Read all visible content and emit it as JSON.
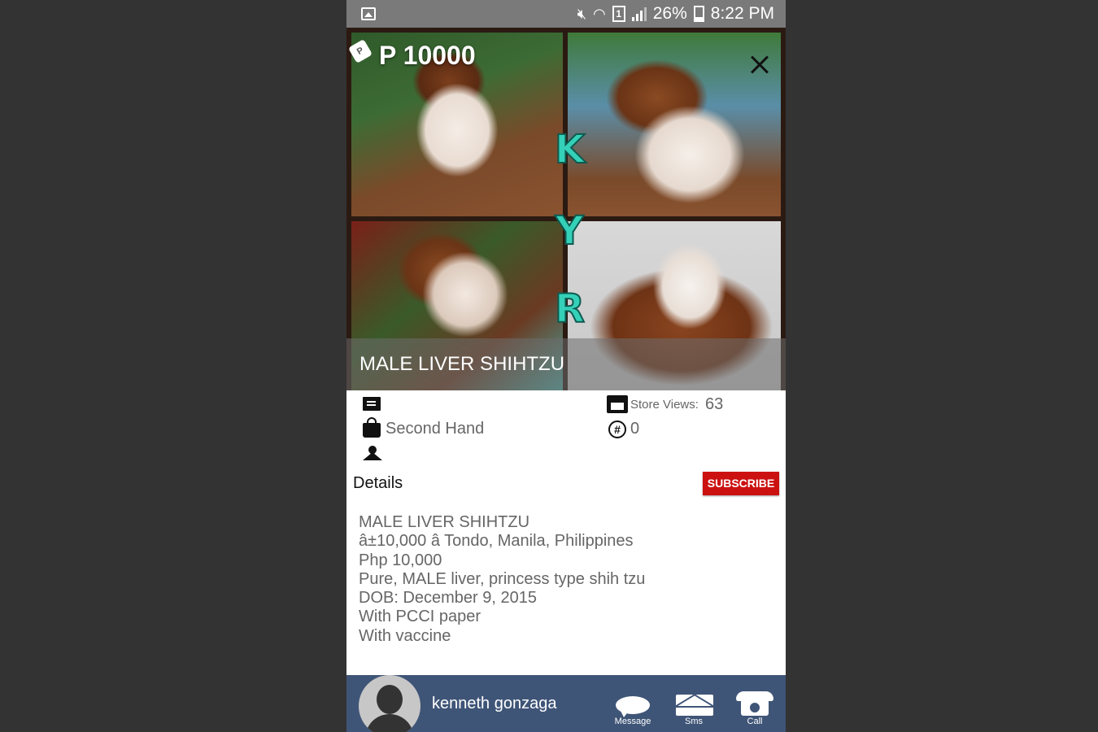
{
  "status_bar": {
    "battery": "26%",
    "time": "8:22 PM",
    "icons": [
      "gallery-icon",
      "mute-icon",
      "wifi-icon",
      "sim-1-icon",
      "signal-icon",
      "battery-charging-icon"
    ],
    "sim_label": "1"
  },
  "listing": {
    "price": "P 10000",
    "price_tag_letter": "P",
    "title": "MALE LIVER SHIHTZU",
    "overlay_letters": [
      "K",
      "Y",
      "R"
    ],
    "condition": "Second Hand",
    "store_views_label": "Store Views:",
    "store_views_value": "63",
    "count_value": "0"
  },
  "details": {
    "heading": "Details",
    "subscribe_label": "SUBSCRIBE",
    "subscribe_color": "#cc1111",
    "lines": [
      "MALE LIVER SHIHTZU",
      "â±10,000 â Tondo, Manila, Philippines",
      "Php 10,000",
      "Pure, MALE liver, princess type shih tzu",
      "DOB: December 9, 2015",
      "With PCCI paper",
      "With vaccine"
    ]
  },
  "footer": {
    "seller_name": "kenneth gonzaga",
    "actions": [
      {
        "label": "Message",
        "icon": "message-bubble-icon"
      },
      {
        "label": "Sms",
        "icon": "envelope-icon"
      },
      {
        "label": "Call",
        "icon": "phone-icon"
      }
    ],
    "background_color": "#3f5577"
  }
}
